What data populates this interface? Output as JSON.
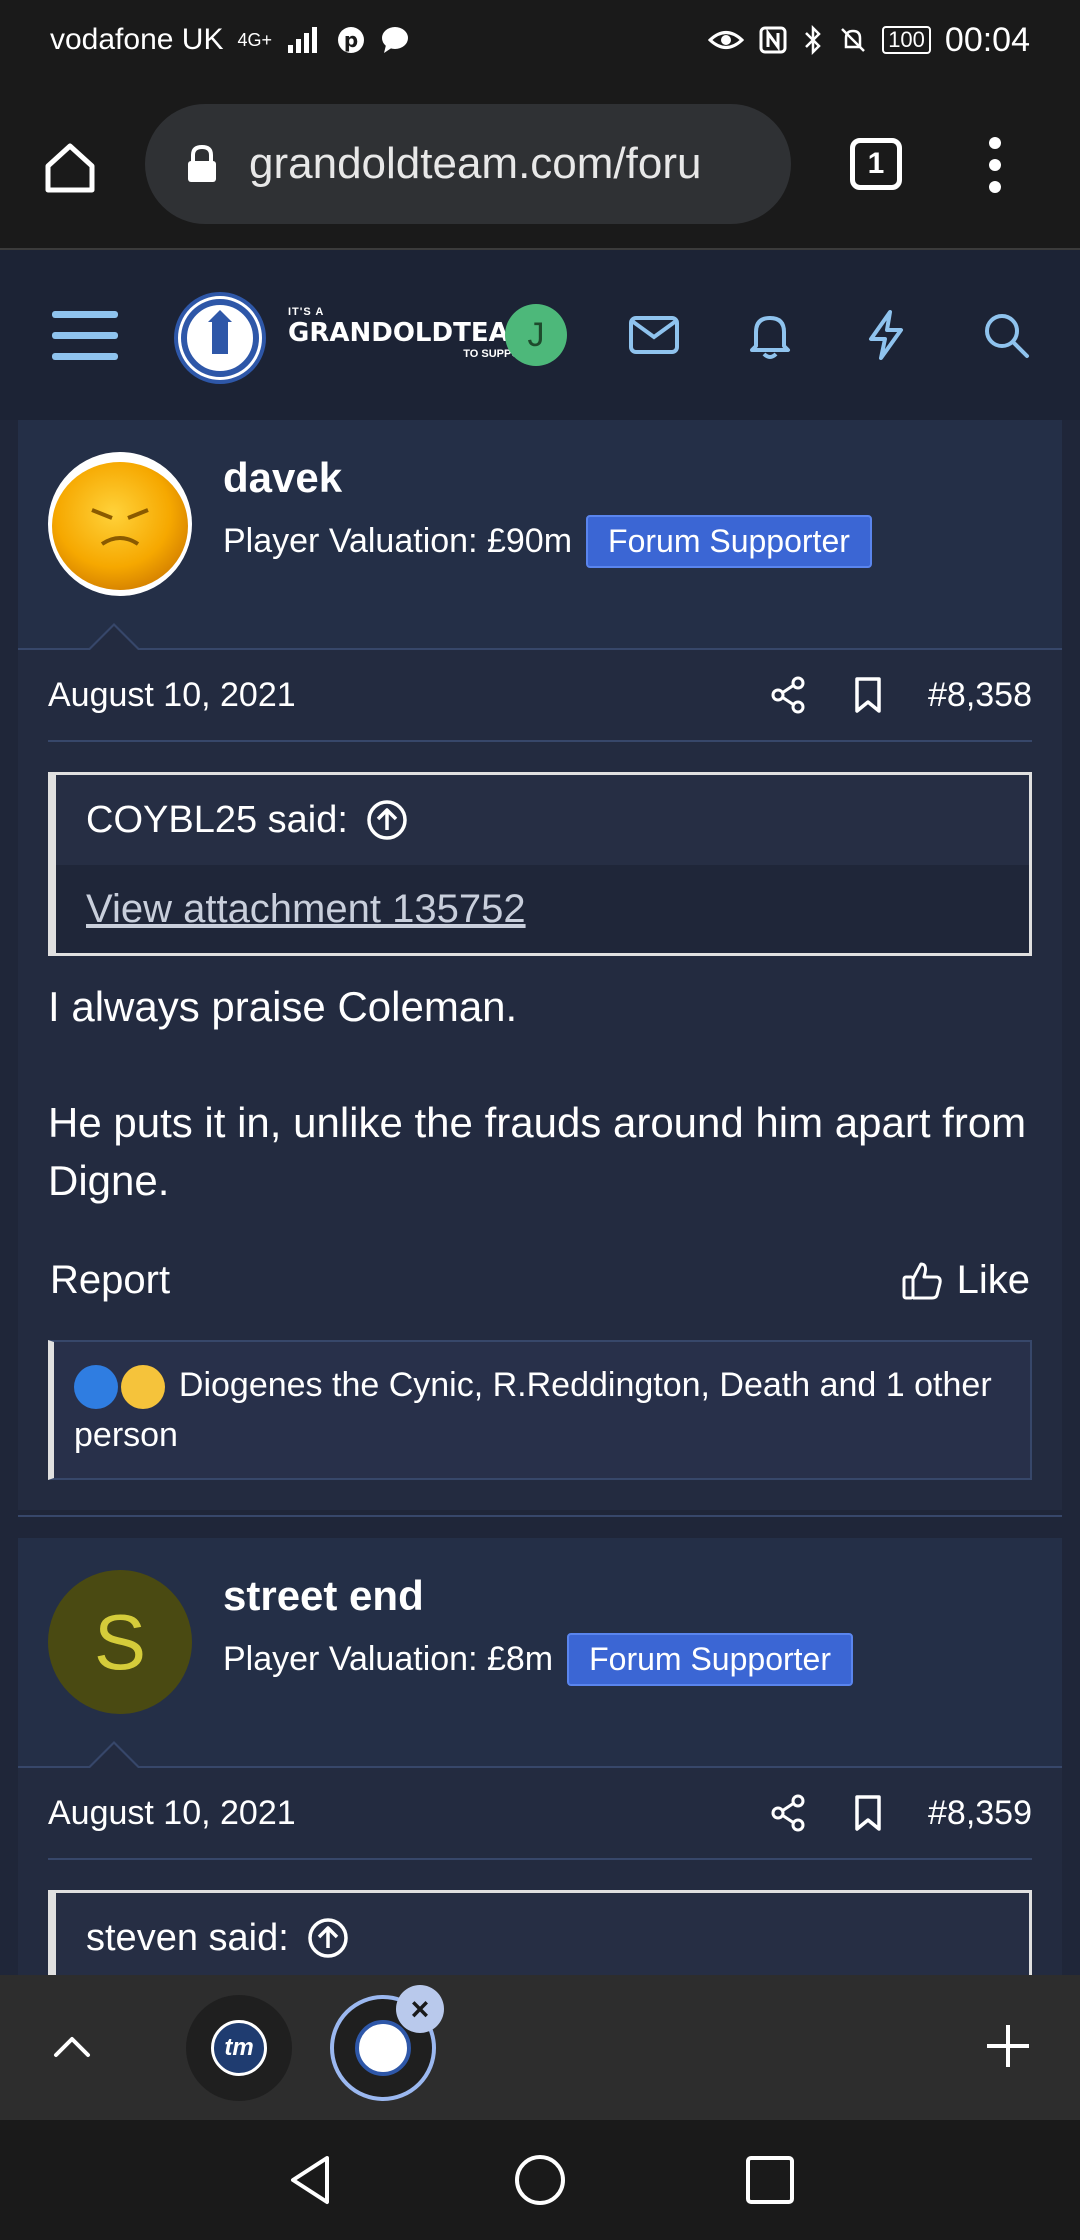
{
  "status_bar": {
    "carrier": "vodafone UK",
    "network": "4G+",
    "battery": "100",
    "time": "00:04"
  },
  "browser": {
    "url": "grandoldteam.com/foru",
    "tab_count": "1"
  },
  "site_header": {
    "logo_top": "IT'S A",
    "logo_main": "GRANDOLDTEAM",
    "logo_sub": "TO SUPPORT",
    "user_initial": "J"
  },
  "posts": [
    {
      "username": "davek",
      "valuation": "Player Valuation: £90m",
      "badge": "Forum Supporter",
      "date": "August 10, 2021",
      "post_number": "#8,358",
      "quote_author": "COYBL25 said:",
      "quote_body": "View attachment 135752",
      "message_lines": [
        "I always praise Coleman.",
        "He puts it in, unlike the frauds around him apart from Digne."
      ],
      "report_label": "Report",
      "like_label": "Like",
      "reactions_text": "Diogenes the Cynic, R.Reddington, Death and 1 other person"
    },
    {
      "username": "street end",
      "avatar_initial": "S",
      "valuation": "Player Valuation: £8m",
      "badge": "Forum Supporter",
      "date": "August 10, 2021",
      "post_number": "#8,359",
      "quote_author": "steven said:"
    }
  ],
  "tab_bar": {
    "tab1_label": "tm",
    "close_label": "×"
  },
  "colors": {
    "site_bg": "#1f2639",
    "post_bg": "#232b40",
    "badge": "#3b66d4",
    "avatar_green": "#4db87a",
    "avatar_olive": "#4a4a12"
  }
}
